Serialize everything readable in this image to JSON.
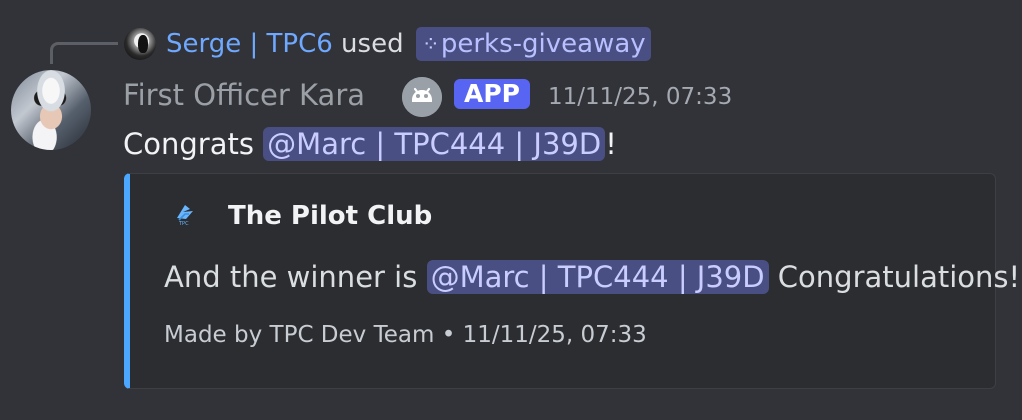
{
  "reply": {
    "author": "Serge | TPC6",
    "used_text": "used",
    "command": "perks-giveaway"
  },
  "message": {
    "author": "First Officer Kara",
    "badge": "APP",
    "timestamp": "11/11/25, 07:33",
    "text_prefix": "Congrats ",
    "mention": "@Marc | TPC444 | J39D",
    "text_suffix": "!"
  },
  "embed": {
    "author": "The Pilot Club",
    "body_prefix": "And the winner is ",
    "body_mention": "@Marc | TPC444 | J39D",
    "body_suffix": " Congratulations!",
    "footer": "Made by TPC Dev Team • 11/11/25, 07:33",
    "accent_color": "#4ca8ff"
  },
  "icons": {
    "command_icon": "slash-command-icon",
    "bot_icon": "discord-bot-icon",
    "embed_author_icon": "pilot-club-logo-icon"
  },
  "colors": {
    "background": "#323338",
    "mention_bg": "#4a4f83",
    "mention_text": "#c9cdff",
    "badge_bg": "#5865f2"
  }
}
